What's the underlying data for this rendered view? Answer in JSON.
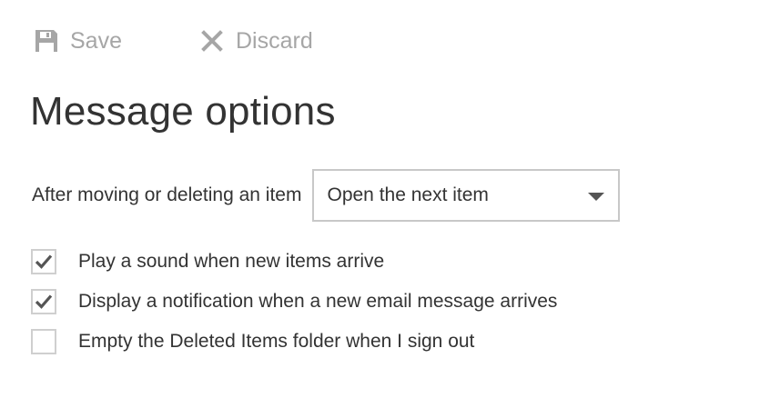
{
  "toolbar": {
    "save": {
      "label": "Save",
      "icon": "save-icon",
      "enabled": false
    },
    "discard": {
      "label": "Discard",
      "icon": "close-icon",
      "enabled": false
    },
    "disabled_color": "#a6a6a6"
  },
  "page": {
    "title": "Message options"
  },
  "after_move_delete": {
    "label": "After moving or deleting an item",
    "selected": "Open the next item"
  },
  "options": [
    {
      "label": "Play a sound when new items arrive",
      "checked": true
    },
    {
      "label": "Display a notification when a new email message arrives",
      "checked": true
    },
    {
      "label": "Empty the Deleted Items folder when I sign out",
      "checked": false
    }
  ],
  "colors": {
    "text": "#333333",
    "border": "#c8c8c8",
    "checkmark": "#555555"
  }
}
